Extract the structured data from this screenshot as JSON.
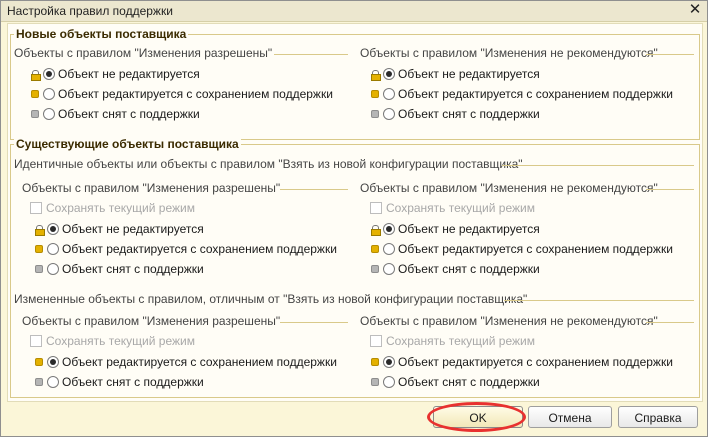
{
  "window": {
    "title": "Настройка правил поддержки"
  },
  "options": {
    "not_editable": "Объект не редактируется",
    "editable_keep": "Объект редактируется с сохранением поддержки",
    "removed": "Объект снят с поддержки"
  },
  "keep_mode_label": "Сохранять текущий режим",
  "new_objects": {
    "title": "Новые объекты поставщика",
    "left_caption": "Объекты с правилом \"Изменения разрешены\"",
    "right_caption": "Объекты с правилом \"Изменения не рекомендуются\""
  },
  "existing_objects": {
    "title": "Существующие объекты поставщика",
    "identical_caption": "Идентичные объекты или объекты с правилом \"Взять из новой конфигурации поставщика\"",
    "changed_caption": "Измененные объекты с правилом, отличным от \"Взять из новой конфигурации поставщика\"",
    "left_caption": "Объекты с правилом \"Изменения разрешены\"",
    "right_caption": "Объекты с правилом \"Изменения не рекомендуются\""
  },
  "buttons": {
    "ok": "OK",
    "cancel": "Отмена",
    "help": "Справка"
  },
  "colors": {
    "background": "#fbf6d8",
    "frame": "#d9c98a",
    "gold_bullet": "#e4b100",
    "annotation": "#e8312f"
  }
}
